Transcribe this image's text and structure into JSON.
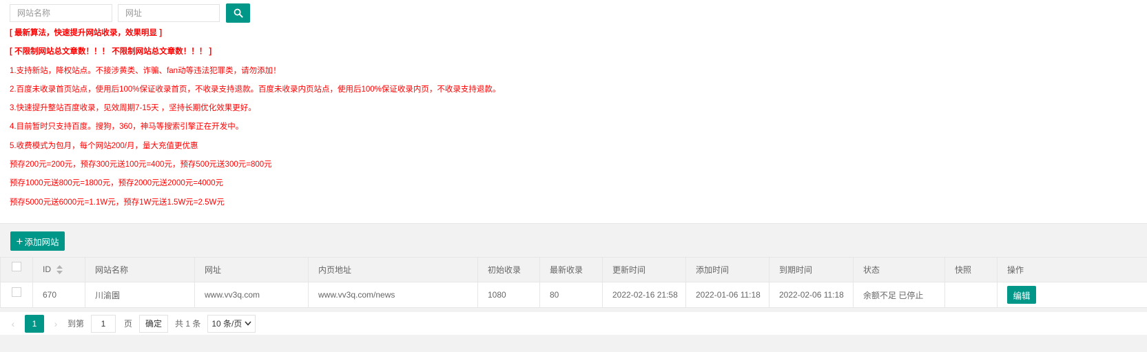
{
  "search": {
    "name_placeholder": "网站名称",
    "url_placeholder": "网址",
    "button_icon": "search-icon"
  },
  "notices": [
    "[ 最新算法，快速提升网站收录，效果明显 ]",
    "[ 不限制网站总文章数！！！ 不限制网站总文章数！！！ ]",
    "1.支持新站，降权站点。不接涉黄类、诈骗、fan动等违法犯罪类，请勿添加！",
    "2.百度未收录首页站点，使用后100%保证收录首页，不收录支持退款。百度未收录内页站点，使用后100%保证收录内页，不收录支持退款。",
    "3.快速提升整站百度收录，见效周期7-15天 ，坚持长期优化效果更好。",
    "4.目前暂时只支持百度。搜狗，360，神马等搜索引擎正在开发中。",
    "5.收费模式为包月，每个网站200/月，量大充值更优惠",
    "预存200元=200元，预存300元送100元=400元，预存500元送300元=800元",
    "预存1000元送800元=1800元，预存2000元送2000元=4000元",
    "预存5000元送6000元=1.1W元，预存1W元送1.5W元=2.5W元"
  ],
  "toolbar": {
    "add_label": "添加网站",
    "add_icon": "plus-icon"
  },
  "table": {
    "headers": [
      "ID",
      "网站名称",
      "网址",
      "内页地址",
      "初始收录",
      "最新收录",
      "更新时间",
      "添加时间",
      "到期时间",
      "状态",
      "快照",
      "操作"
    ],
    "rows": [
      {
        "id": "670",
        "name": "川渝園",
        "url": "www.vv3q.com",
        "inner_url": "www.vv3q.com/news",
        "initial": "1080",
        "latest": "80",
        "updated": "2022-02-16 21:58",
        "added": "2022-01-06 11:18",
        "expires": "2022-02-06 11:18",
        "status": "余额不足 已停止",
        "snapshot": "",
        "action": "编辑"
      }
    ]
  },
  "pagination": {
    "current_page": "1",
    "goto_label": "到第",
    "goto_value": "1",
    "page_unit": "页",
    "confirm_label": "确定",
    "total_label": "共 1 条",
    "page_size": "10 条/页",
    "prev_icon": "chevron-left-icon",
    "next_icon": "chevron-right-icon"
  },
  "colors": {
    "accent": "#009688",
    "notice_text": "#ff0000",
    "panel_bg": "#f2f2f2",
    "border": "#e6e6e6"
  }
}
